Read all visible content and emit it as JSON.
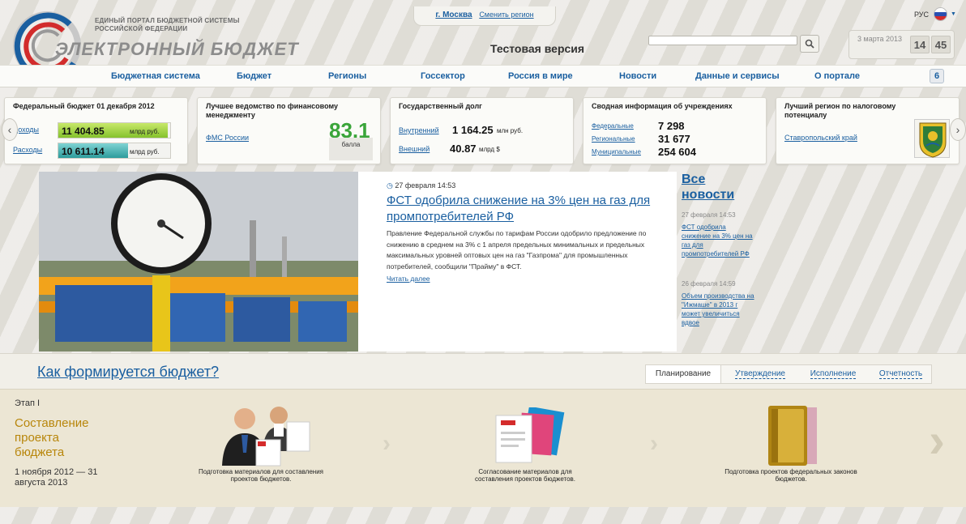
{
  "header": {
    "portal_name": "ЕДИНЫЙ ПОРТАЛ БЮДЖЕТНОЙ СИСТЕМЫ РОССИЙСКОЙ ФЕДЕРАЦИИ",
    "site_title": "ЭЛЕКТРОННЫЙ БЮДЖЕТ",
    "city": "г. Москва",
    "change_city": "Сменить регион",
    "test_version": "Тестовая версия",
    "date": "3 марта 2013",
    "clock_hours": "14",
    "clock_minutes": "45",
    "language": "РУС"
  },
  "nav": {
    "items": [
      "Бюджетная система",
      "Бюджет",
      "Регионы",
      "Госсектор",
      "Россия в мире",
      "Новости",
      "Данные и сервисы",
      "О портале"
    ],
    "badge": "6"
  },
  "cards": {
    "federal_budget": {
      "title": "Федеральный бюджет 01 декабря 2012",
      "income_label": "Доходы",
      "income_value": "11 404.85",
      "income_fill": 0.98,
      "expense_label": "Расходы",
      "expense_value": "10 611.14",
      "expense_fill": 0.62,
      "unit": "млрд руб."
    },
    "best_agency": {
      "title": "Лучшее ведомство по финансовому менеджменту",
      "agency": "ФМС России",
      "score": "83,1",
      "score_label": "балла"
    },
    "state_debt": {
      "title": "Государственный долг",
      "internal_label": "Внутренний",
      "internal_value": "1 164.25",
      "internal_unit": "млн руб.",
      "external_label": "Внешний",
      "external_value": "40.87",
      "external_unit": "млрд $"
    },
    "institutions": {
      "title": "Сводная информация об учреждениях",
      "rows": [
        {
          "label": "Федеральные",
          "value": "7 298"
        },
        {
          "label": "Региональные",
          "value": "31 677"
        },
        {
          "label": "Муниципальные",
          "value": "254 604"
        }
      ]
    },
    "best_region": {
      "title": "Лучший регион по налоговому потенциалу",
      "region": "Ставропольский край"
    }
  },
  "news": {
    "date": "27 февраля 14:53",
    "headline": "ФСТ одобрила снижение на 3% цен на газ для промпотребителей РФ",
    "body": "Правление Федеральной службы по тарифам России одобрило предложение по снижению в среднем на 3% с 1 апреля предельных минимальных и предельных максимальных уровней оптовых цен на газ \"Газпрома\" для промышленных потребителей, сообщили \"Прайму\" в ФСТ.",
    "read_more": "Читать далее",
    "all_news": "Все новости",
    "side": [
      {
        "date": "27 февраля 14:53",
        "title": "ФСТ одобрила снижение на 3% цен на газ для промпотребителей РФ"
      },
      {
        "date": "26 февраля 14:59",
        "title": "Объем производства на \"Ижмаше\" в 2013 г может увеличиться вдвое"
      }
    ]
  },
  "budget": {
    "title": "Как формируется бюджет?",
    "tabs": [
      "Планирование",
      "Утверждение",
      "Исполнение",
      "Отчетность"
    ],
    "stage_label": "Этап I",
    "stage_title": "Составление проекта бюджета",
    "stage_dates": "1 ноября 2012 — 31 августа 2013",
    "steps": [
      "Подготовка материалов для составления проектов бюджетов.",
      "Согласование материалов для составления проектов бюджетов.",
      "Подготовка проектов федеральных законов бюджетов."
    ]
  },
  "colors": {
    "brand_blue": "#1a5fa0",
    "accent_green": "#3aa53a",
    "stage_gold": "#b8860b"
  }
}
